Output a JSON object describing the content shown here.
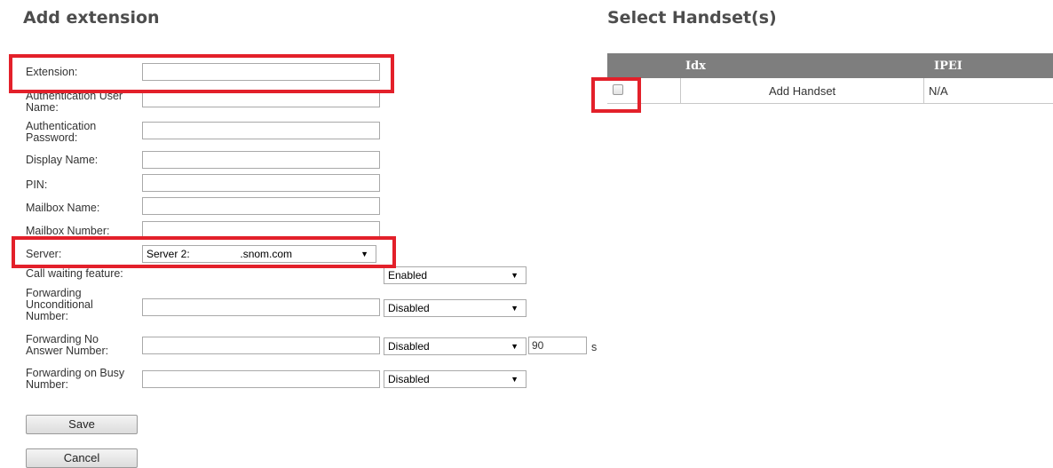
{
  "left": {
    "title": "Add extension",
    "fields": {
      "extension": "Extension:",
      "auth_user": "Authentication User Name:",
      "auth_pass": "Authentication Password:",
      "display_name": "Display Name:",
      "pin": "PIN:",
      "mailbox_name": "Mailbox Name:",
      "mailbox_number": "Mailbox Number:",
      "server": "Server:",
      "call_waiting": "Call waiting feature:",
      "fwd_unconditional": "Forwarding Unconditional Number:",
      "fwd_no_answer": "Forwarding No Answer Number:",
      "fwd_busy": "Forwarding on Busy Number:"
    },
    "server_value_prefix": "Server 2:",
    "server_value_suffix": ".snom.com",
    "call_waiting_value": "Enabled",
    "fwd_unconditional_mode": "Disabled",
    "fwd_no_answer_mode": "Disabled",
    "fwd_no_answer_timeout": "90",
    "fwd_no_answer_unit": "s",
    "fwd_busy_mode": "Disabled",
    "save_label": "Save",
    "cancel_label": "Cancel"
  },
  "right": {
    "title": "Select Handset(s)",
    "table": {
      "headers": [
        "Idx",
        "IPEI"
      ],
      "rows": [
        {
          "idx": "",
          "name": "Add Handset",
          "ipei": "N/A"
        }
      ]
    }
  },
  "icons": {
    "dropdown": "▼"
  },
  "colors": {
    "highlight": "#e3202a",
    "table_header": "#7e7e7e"
  }
}
